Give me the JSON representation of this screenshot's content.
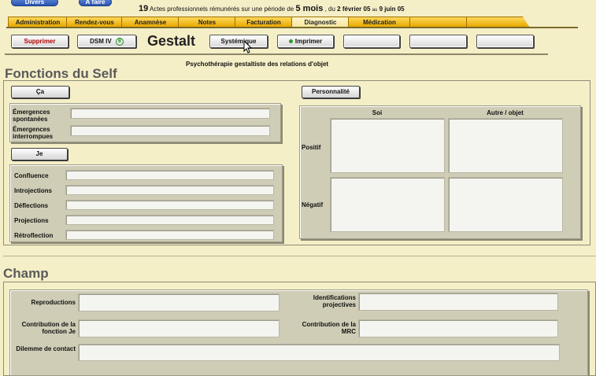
{
  "top": {
    "divers_label": "Divers",
    "second_label": "À faire",
    "count": "19",
    "text1": "Actes professionnels rémunérés sur une période de",
    "period": "5 mois",
    "text2": ", du",
    "date_from": "2 février 05",
    "text3": "au",
    "date_to": "9 juin 05"
  },
  "tabs": [
    {
      "label": "Administration"
    },
    {
      "label": "Rendez-vous"
    },
    {
      "label": "Anamnèse"
    },
    {
      "label": "Notes"
    },
    {
      "label": "Facturation"
    },
    {
      "label": "Diagnostic"
    },
    {
      "label": "Médication"
    },
    {
      "label": ""
    },
    {
      "label": ""
    }
  ],
  "toolbar": {
    "delete_label": "Supprimer",
    "dsm_label": "DSM IV",
    "dsm_icon_glyph": "θ",
    "title": "Gestalt",
    "systemic_label": "Systémique",
    "print_label": "Imprimer"
  },
  "subtitle": "Psychothérapie gestaltiste des relations d'objet",
  "self": {
    "heading": "Fonctions du Self",
    "ca_button": "Ça",
    "ca_fields": [
      {
        "label": "Émergences spontanées",
        "value": ""
      },
      {
        "label": "Émergences interrompues",
        "value": ""
      }
    ],
    "je_button": "Je",
    "je_fields": [
      {
        "label": "Confluence",
        "value": ""
      },
      {
        "label": "Introjections",
        "value": ""
      },
      {
        "label": "Déflections",
        "value": ""
      },
      {
        "label": "Projections",
        "value": ""
      },
      {
        "label": "Rétroflection",
        "value": ""
      }
    ],
    "personality_button": "Personnalité",
    "grid": {
      "col1": "Soi",
      "col2": "Autre / objet",
      "row1": "Positif",
      "row2": "Négatif"
    }
  },
  "champ": {
    "heading": "Champ",
    "reproductions": "Reproductions",
    "identifications": "Identifications projectives",
    "contribution_je": "Contribution de la fonction Je",
    "contribution_mrc": "Contribution de la MRC",
    "dilemme": "Dilemme de contact"
  },
  "colors": {
    "background": "#f5efc8",
    "tab": "#f0b400",
    "panel": "#cfcdb6",
    "accent_red": "#b00000"
  }
}
